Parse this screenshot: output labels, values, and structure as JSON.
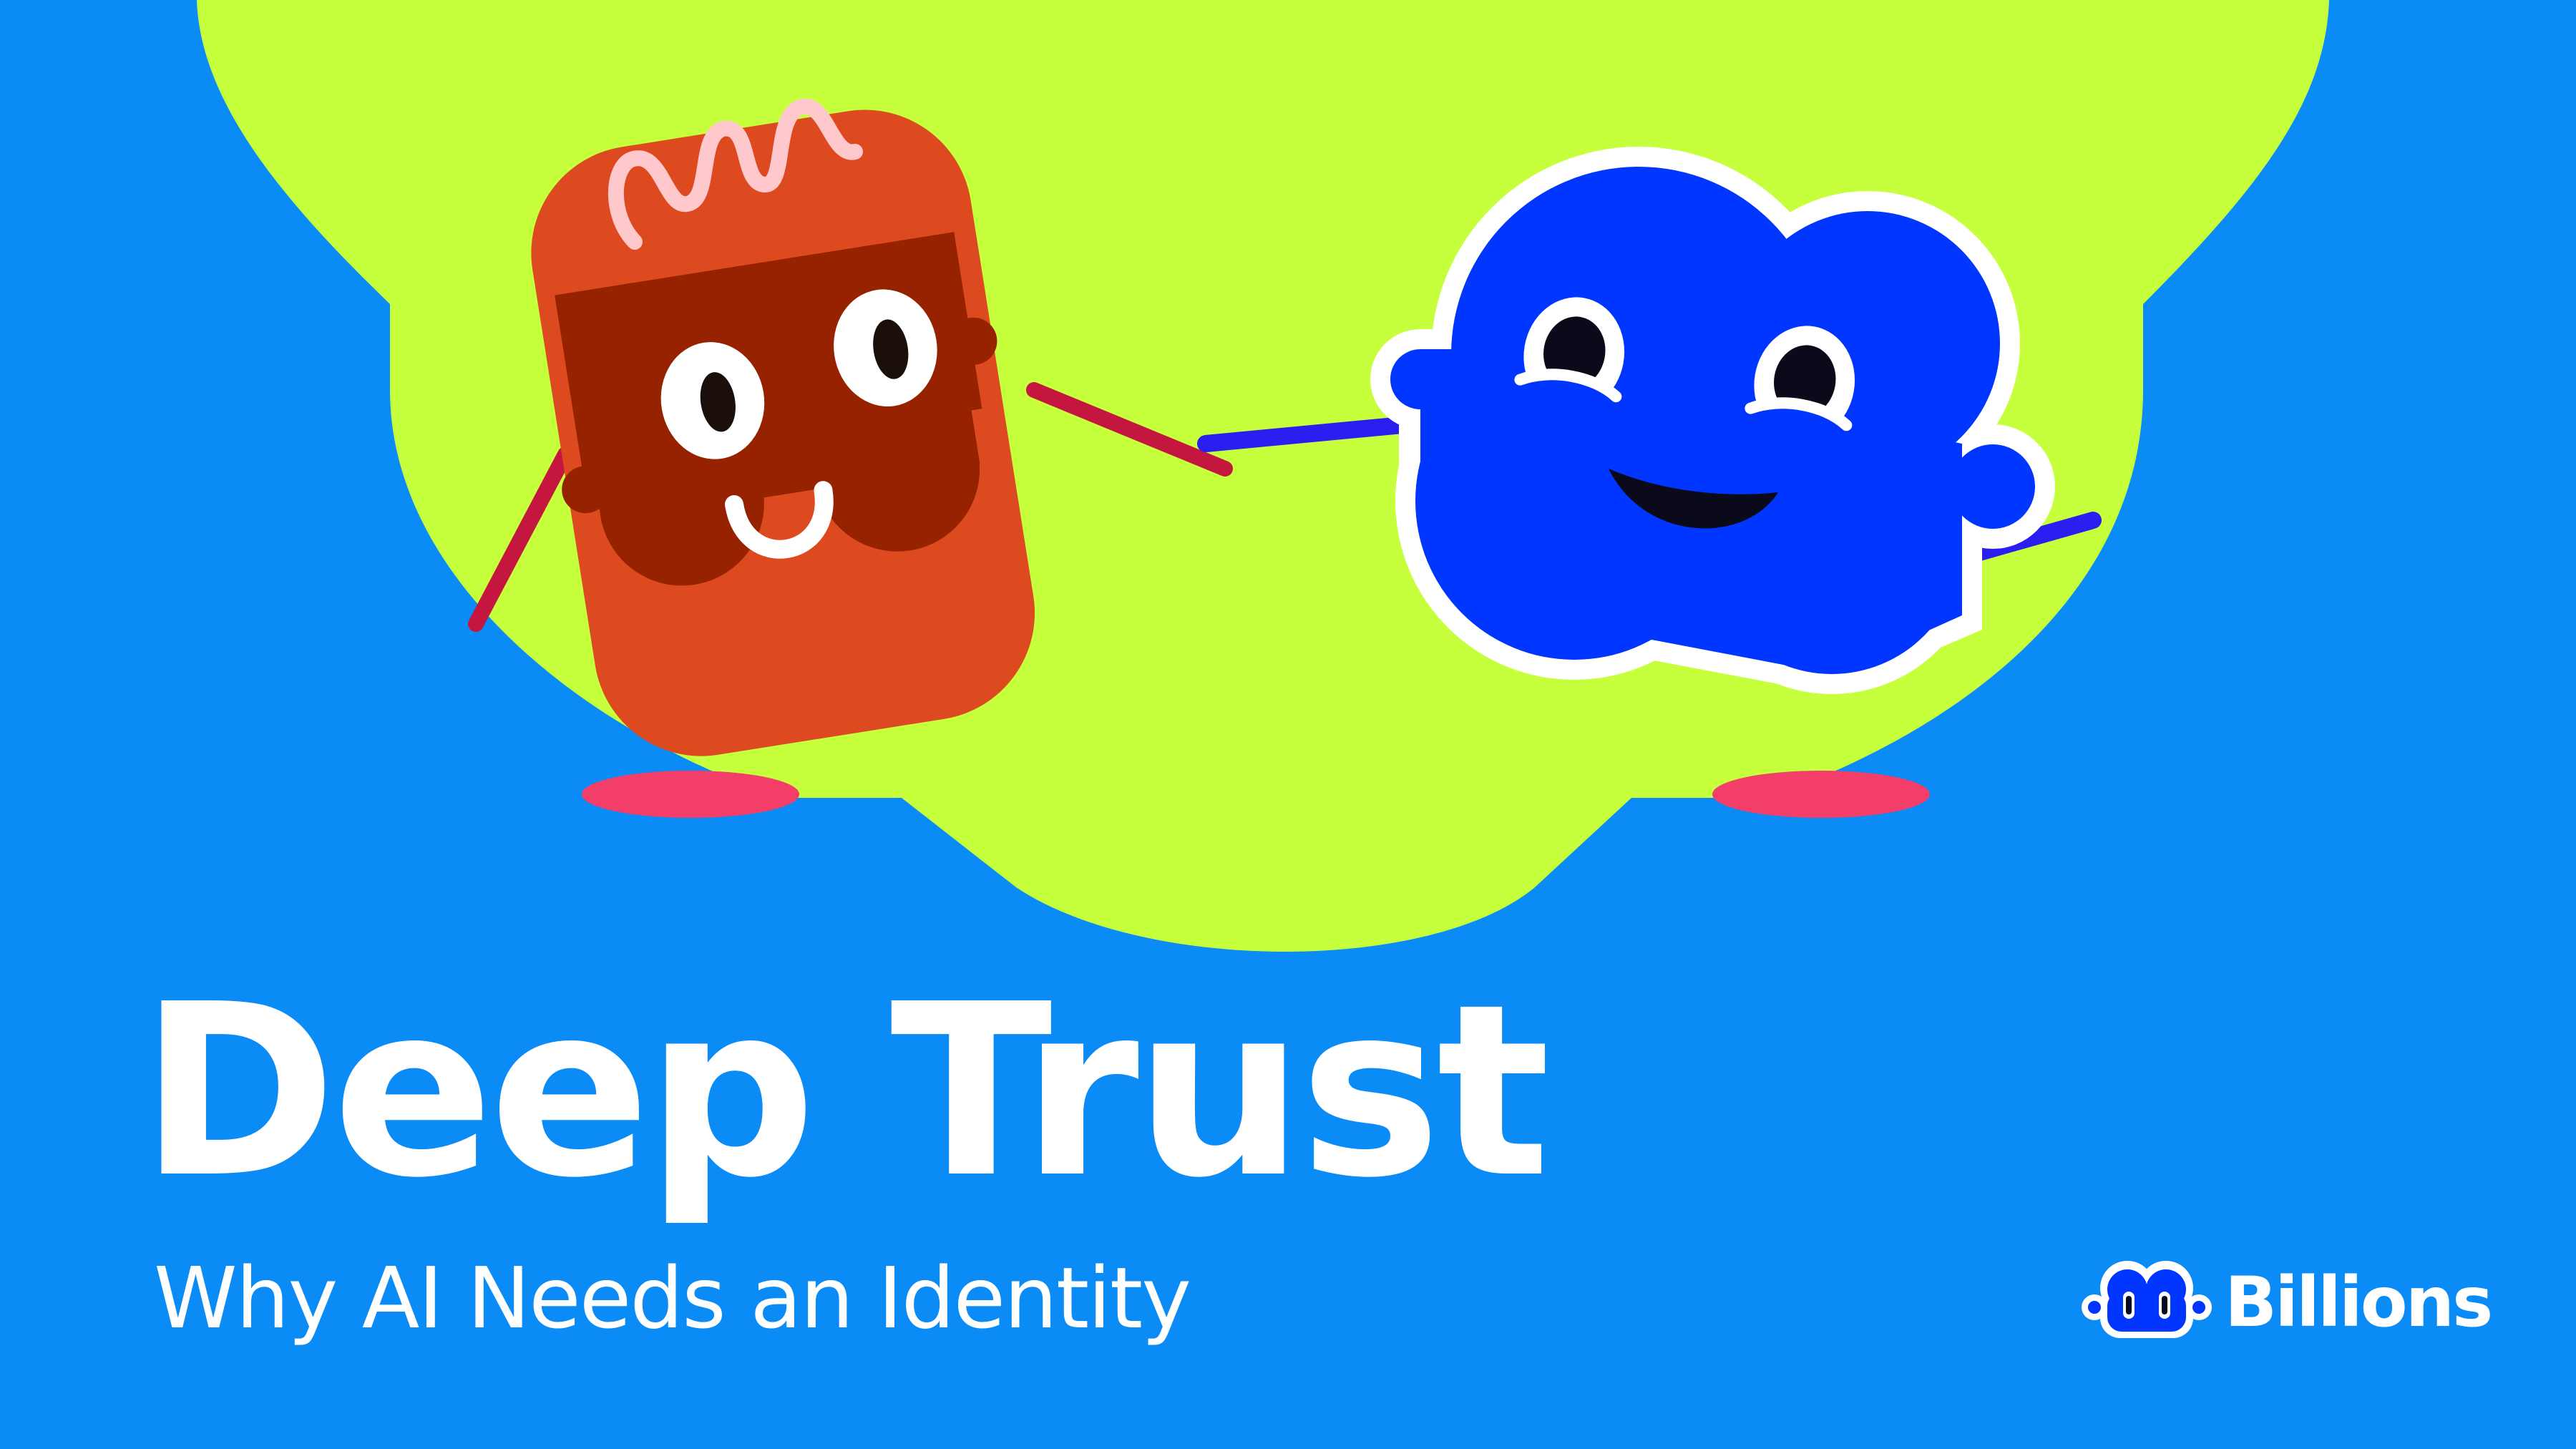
{
  "colors": {
    "background": "#0a8bf5",
    "blob": "#c6ff3c",
    "orange_character": "#dd4a1f",
    "orange_face": "#962200",
    "blue_character": "#0036ff",
    "feet": "#f23e68",
    "text": "#ffffff"
  },
  "heading": {
    "title": "Deep Trust",
    "subtitle": "Why AI Needs an Identity"
  },
  "brand": {
    "name": "Billions",
    "icon": "billions-logo-icon"
  }
}
